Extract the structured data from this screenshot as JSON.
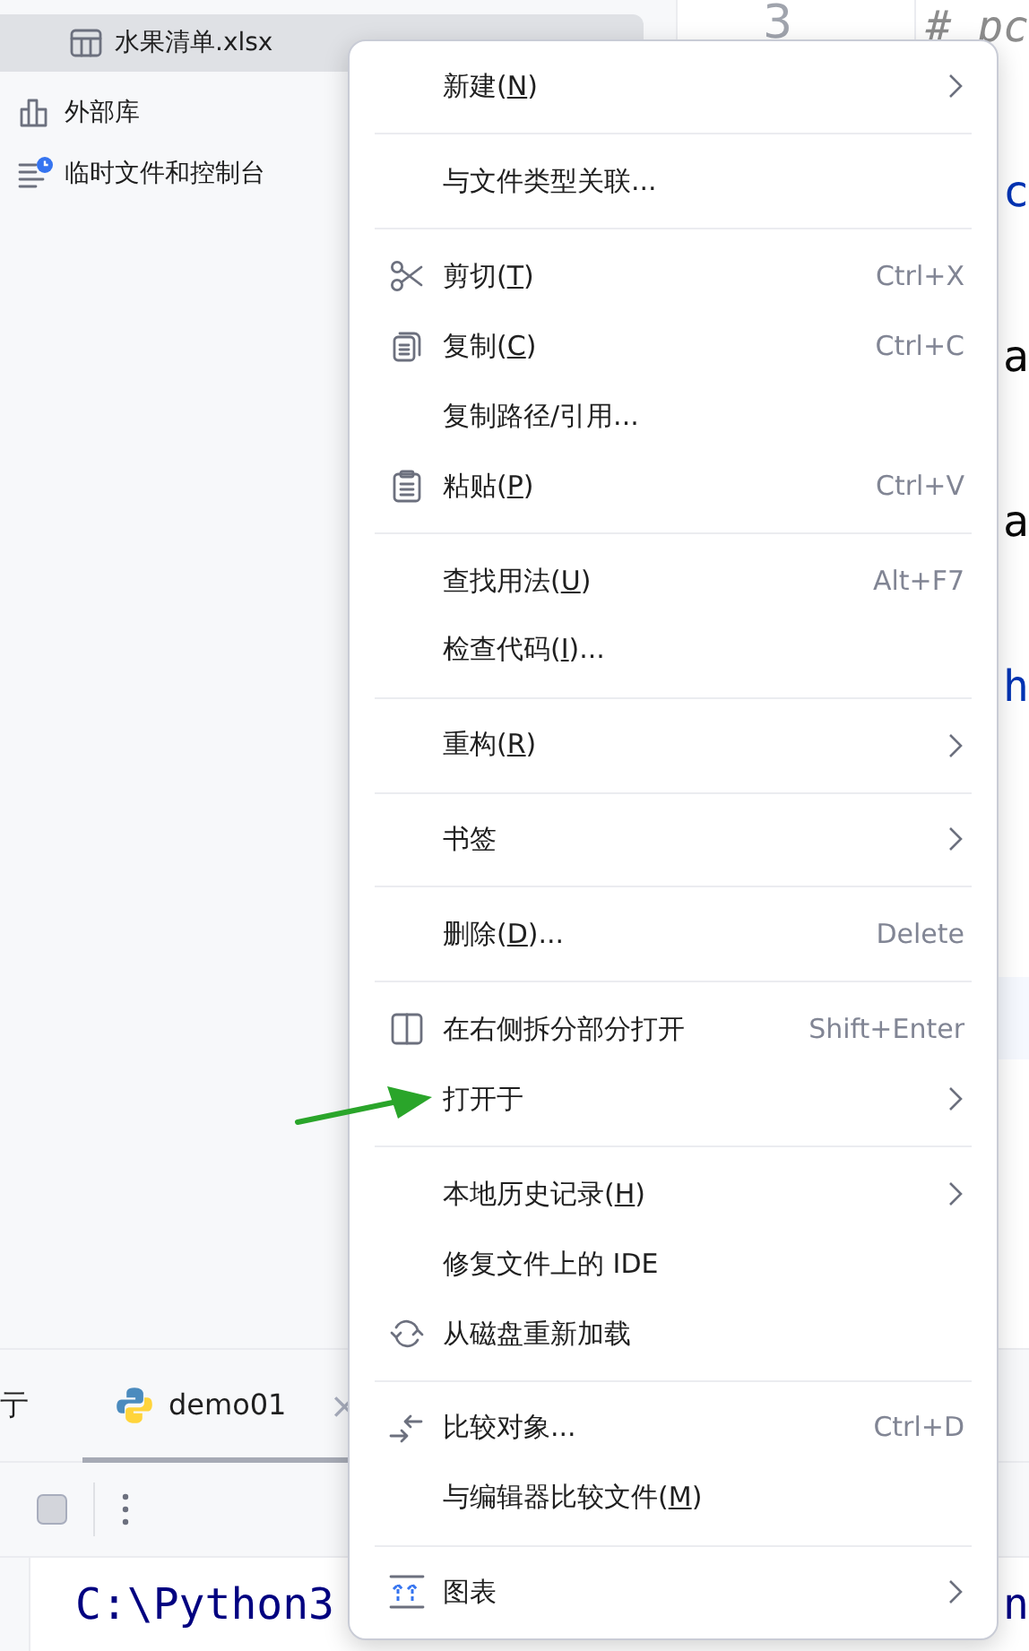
{
  "sidebar": {
    "items": [
      {
        "label": "水果清单.xlsx",
        "selected": true
      },
      {
        "label": "外部库",
        "selected": false
      },
      {
        "label": "临时文件和控制台",
        "selected": false
      }
    ]
  },
  "editor": {
    "line_number": "3",
    "lines": [
      {
        "text": "# pc",
        "kind": "comment"
      },
      {
        "text": "c",
        "kind": "keyword"
      },
      {
        "text": "a",
        "kind": "plain"
      },
      {
        "text": "a",
        "kind": "plain"
      },
      {
        "text": "h",
        "kind": "keyword"
      }
    ]
  },
  "bottom_panel": {
    "tabs": [
      {
        "label": "亍",
        "selected": false
      },
      {
        "label": "demo01",
        "selected": true,
        "close": "×"
      }
    ],
    "console_lines": [
      {
        "text": "C:\\Python3"
      },
      {
        "text": "n"
      }
    ]
  },
  "context_menu": {
    "groups": [
      [
        {
          "label": "新建(",
          "mnemonic": "N",
          "after": ")",
          "submenu": true
        }
      ],
      [
        {
          "label": "与文件类型关联...",
          "submenu": false
        }
      ],
      [
        {
          "label": "剪切(",
          "mnemonic": "T",
          "after": ")",
          "shortcut": "Ctrl+X",
          "submenu": false
        },
        {
          "label": "复制(",
          "mnemonic": "C",
          "after": ")",
          "shortcut": "Ctrl+C",
          "submenu": false
        },
        {
          "label": "复制路径/引用...",
          "submenu": false
        },
        {
          "label": "粘贴(",
          "mnemonic": "P",
          "after": ")",
          "shortcut": "Ctrl+V",
          "submenu": false
        }
      ],
      [
        {
          "label": "查找用法(",
          "mnemonic": "U",
          "after": ")",
          "shortcut": "Alt+F7",
          "submenu": false
        },
        {
          "label": "检查代码(",
          "mnemonic": "I",
          "after": ")...",
          "submenu": false
        }
      ],
      [
        {
          "label": "重构(",
          "mnemonic": "R",
          "after": ")",
          "submenu": true
        }
      ],
      [
        {
          "label": "书签",
          "submenu": true
        }
      ],
      [
        {
          "label": "删除(",
          "mnemonic": "D",
          "after": ")...",
          "shortcut": "Delete",
          "submenu": false
        }
      ],
      [
        {
          "label": "在右侧拆分部分打开",
          "shortcut": "Shift+Enter",
          "submenu": false
        },
        {
          "label": "打开于",
          "submenu": true
        }
      ],
      [
        {
          "label": "本地历史记录(",
          "mnemonic": "H",
          "after": ")",
          "submenu": true
        },
        {
          "label": "修复文件上的 IDE",
          "submenu": false
        },
        {
          "label": "从磁盘重新加载",
          "submenu": false
        }
      ],
      [
        {
          "label": "比较对象...",
          "shortcut": "Ctrl+D",
          "submenu": false
        },
        {
          "label": "与编辑器比较文件(",
          "mnemonic": "M",
          "after": ")",
          "submenu": false
        }
      ],
      [
        {
          "label": "图表",
          "submenu": true
        }
      ]
    ]
  }
}
